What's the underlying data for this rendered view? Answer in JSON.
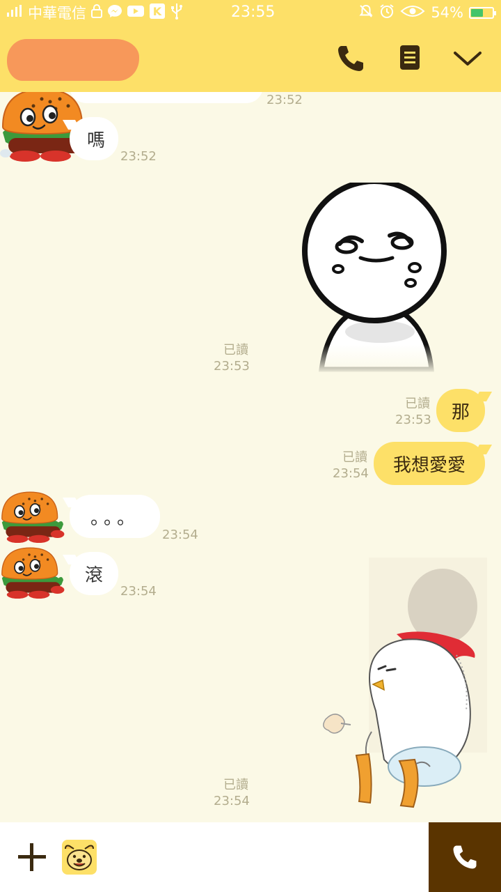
{
  "status_bar": {
    "carrier": "中華電信",
    "time": "23:55",
    "battery_percent": "54%",
    "battery_level": 0.54
  },
  "header": {
    "contact_name": "",
    "icons": [
      "phone-icon",
      "menu-icon",
      "chevron-down-icon"
    ]
  },
  "messages": {
    "top_partial_time": "23:52",
    "m1": {
      "text": "嗎",
      "time": "23:52"
    },
    "s1": {
      "read": "已讀",
      "time": "23:53"
    },
    "m2": {
      "text": "那",
      "read": "已讀",
      "time": "23:53"
    },
    "m3": {
      "text": "我想愛愛",
      "read": "已讀",
      "time": "23:54"
    },
    "m4": {
      "text": "。。。",
      "time": "23:54"
    },
    "m5": {
      "text": "滾",
      "time": "23:54"
    },
    "s2": {
      "read": "已讀",
      "time": "23:54"
    }
  },
  "bottom_bar": {
    "icons": [
      "plus-icon",
      "emoticon-icon",
      "call-icon"
    ]
  },
  "colors": {
    "header": "#fde068",
    "background": "#fbf9e6",
    "my_bubble": "#fde068",
    "their_bubble": "#ffffff",
    "call_button": "#5a3400"
  }
}
